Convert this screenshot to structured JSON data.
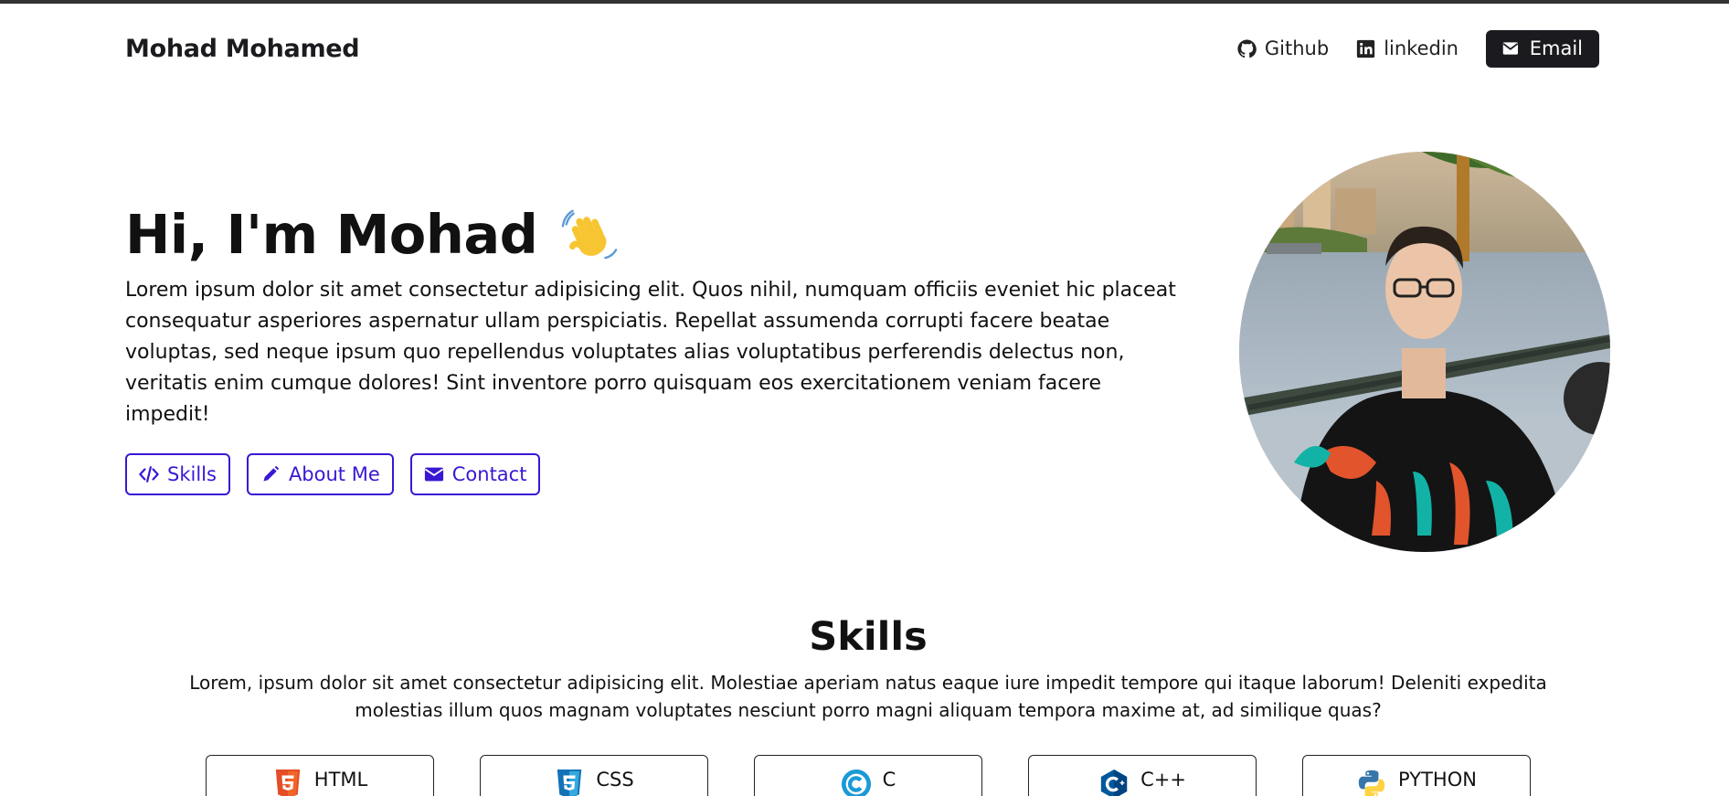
{
  "nav": {
    "brand": "Mohad Mohamed",
    "links": [
      {
        "label": "Github",
        "icon": "github-icon"
      },
      {
        "label": "linkedin",
        "icon": "linkedin-icon"
      }
    ],
    "email_label": "Email"
  },
  "hero": {
    "title": "Hi, I'm Mohad",
    "text": "Lorem ipsum dolor sit amet consectetur adipisicing elit. Quos nihil, numquam officiis eveniet hic placeat consequatur asperiores aspernatur ullam perspiciatis. Repellat assumenda corrupti facere beatae voluptas, sed neque ipsum quo repellendus voluptates alias voluptatibus perferendis delectus non, veritatis enim cumque dolores! Sint inventore porro quisquam eos exercitationem veniam facere impedit!",
    "buttons": [
      {
        "label": "Skills",
        "icon": "code-icon"
      },
      {
        "label": "About Me",
        "icon": "pencil-icon"
      },
      {
        "label": "Contact",
        "icon": "envelope-icon"
      }
    ]
  },
  "skills": {
    "title": "Skills",
    "text": "Lorem, ipsum dolor sit amet consectetur adipisicing elit. Molestiae aperiam natus eaque iure impedit tempore qui itaque laborum! Deleniti expedita molestias illum quos magnam voluptates nesciunt porro magni aliquam tempora maxime at, ad similique quas?",
    "cards": [
      {
        "label": "HTML",
        "icon": "html5-icon"
      },
      {
        "label": "CSS",
        "icon": "css3-icon"
      },
      {
        "label": "C",
        "icon": "c-icon"
      },
      {
        "label": "C++",
        "icon": "cplusplus-icon"
      },
      {
        "label": "PYTHON",
        "icon": "python-icon"
      }
    ]
  },
  "colors": {
    "accent": "#3a17d4",
    "dark": "#1b1b1f"
  }
}
